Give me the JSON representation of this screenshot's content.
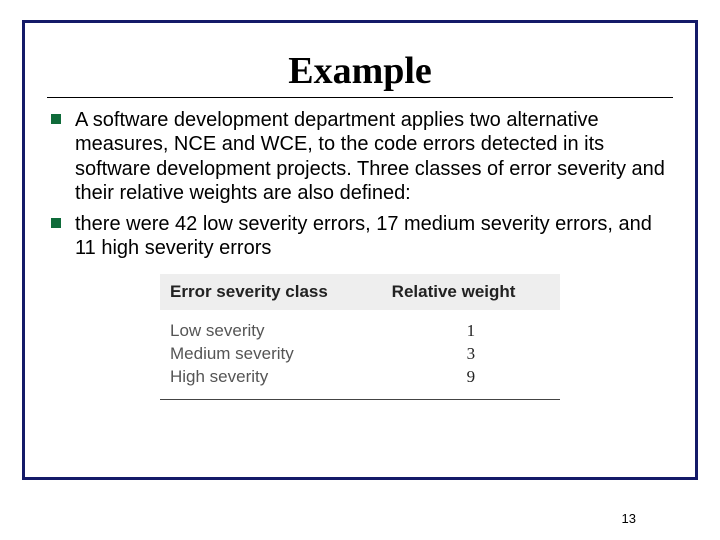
{
  "title": "Example",
  "bullets": [
    "A software development department applies two alternative measures, NCE and WCE, to the code errors detected in its software development projects. Three classes of error severity and their relative weights are also defined:",
    "there were 42 low severity errors, 17 medium severity errors, and 11 high severity errors"
  ],
  "table": {
    "headers": {
      "col1": "Error severity class",
      "col2": "Relative weight"
    },
    "rows": [
      {
        "label": "Low severity",
        "weight": "1"
      },
      {
        "label": "Medium severity",
        "weight": "3"
      },
      {
        "label": "High severity",
        "weight": "9"
      }
    ]
  },
  "page_number": "13"
}
